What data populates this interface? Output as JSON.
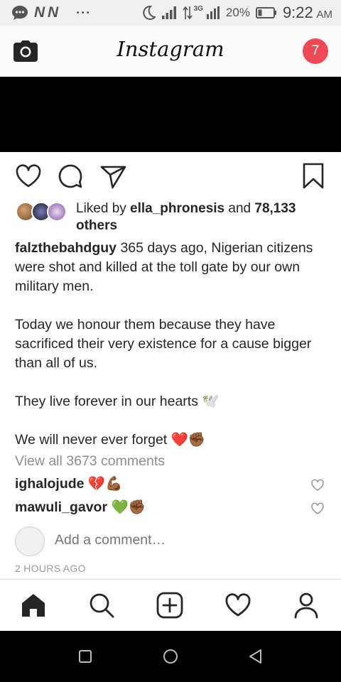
{
  "status_bar": {
    "network_label": "N N",
    "dots": "···",
    "signal_label": "3G",
    "battery": "20%",
    "time": "9:22",
    "ampm": "AM"
  },
  "header": {
    "brand": "Instagram",
    "notification_count": "7"
  },
  "post": {
    "liked_by_prefix": "Liked by ",
    "liked_by_user": "ella_phronesis",
    "liked_by_and": " and ",
    "liked_by_count": "78,133 others",
    "caption": {
      "username": "falzthebahdguy",
      "line1": "365 days ago, Nigerian citizens were shot and killed at the toll gate by our own military men.",
      "line2": "Today we honour them because they have sacrificed their very existence for a cause bigger than all of us.",
      "line3": "They live forever in our hearts 🕊️",
      "line4": "We will never ever forget ❤️✊🏾"
    },
    "view_comments": "View all 3673 comments",
    "comments": [
      {
        "username": "ighalojude",
        "text": "💔💪🏾"
      },
      {
        "username": "mawuli_gavor",
        "text": "💚✊🏾"
      }
    ],
    "add_comment_placeholder": "Add a comment…",
    "timestamp": "2 HOURS AGO"
  },
  "icons": {
    "camera": "camera-icon",
    "like": "heart-icon",
    "comment": "comment-icon",
    "share": "send-icon",
    "save": "bookmark-icon",
    "home": "home-icon",
    "search": "search-icon",
    "new_post": "plus-square-icon",
    "activity": "heart-icon",
    "profile": "user-icon"
  },
  "colors": {
    "badge": "#ed4956",
    "text": "#262626",
    "muted": "#8e8e8e"
  }
}
